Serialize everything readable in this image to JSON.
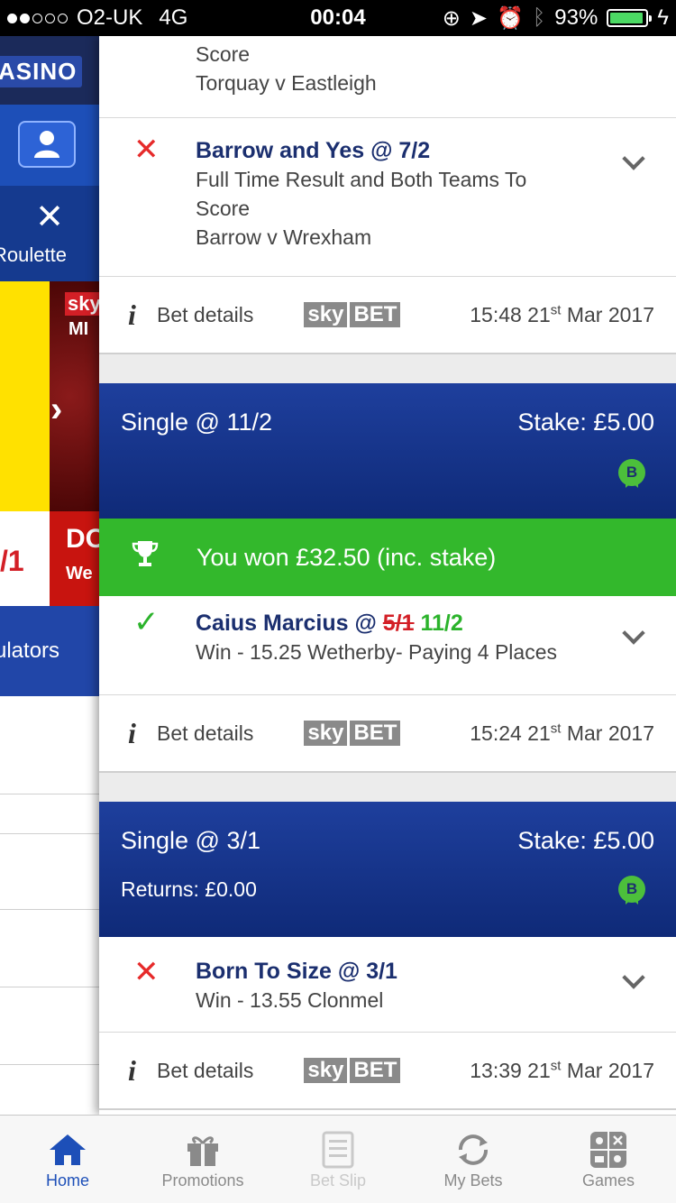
{
  "status_bar": {
    "carrier": "O2-UK",
    "network": "4G",
    "time": "00:04",
    "battery": "93%",
    "battery_level": 0.93
  },
  "left_app": {
    "casino_label": "ASINO",
    "roulette_label": "Roulette",
    "promo_sky": "sky",
    "promo_mi": "MI",
    "promo_odds": "/1",
    "promo_do": "DO",
    "promo_we": "We",
    "accumulators_label": "ulators"
  },
  "bets": {
    "bet1": {
      "partial_leg": {
        "desc_line": "Score",
        "match": "Torquay v Eastleigh"
      },
      "leg2": {
        "title": "Barrow and Yes @ 7/2",
        "market": "Full Time Result and Both Teams To Score",
        "match": "Barrow v Wrexham"
      },
      "details": {
        "label": "Bet details",
        "time": "15:48 21",
        "suffix": "st",
        "month": "Mar 2017"
      }
    },
    "bet2": {
      "single": "Single @ 11/2",
      "stake": "Stake: £5.00",
      "won_text": "You won £32.50 (inc. stake)",
      "leg": {
        "title_prefix": "Caius Marcius @ ",
        "old_odds": "5/1",
        "new_odds": "11/2",
        "desc": "Win - 15.25 Wetherby- Paying 4 Places"
      },
      "details": {
        "label": "Bet details",
        "time": "15:24 21",
        "suffix": "st",
        "month": "Mar 2017"
      }
    },
    "bet3": {
      "single": "Single @ 3/1",
      "stake": "Stake: £5.00",
      "returns": "Returns: £0.00",
      "leg": {
        "title": "Born To Size @ 3/1",
        "desc": "Win - 13.55 Clonmel"
      },
      "details": {
        "label": "Bet details",
        "time": "13:39 21",
        "suffix": "st",
        "month": "Mar 2017"
      }
    }
  },
  "badge_letter": "B",
  "skybet": {
    "sky": "sky",
    "bet": "BET"
  },
  "tabs": [
    {
      "label": "Home",
      "icon": "home-icon"
    },
    {
      "label": "Promotions",
      "icon": "gift-icon"
    },
    {
      "label": "Bet Slip",
      "icon": "betslip-icon"
    },
    {
      "label": "My Bets",
      "icon": "refresh-icon"
    },
    {
      "label": "Games",
      "icon": "games-icon"
    }
  ],
  "colors": {
    "brand_blue": "#1d4fb8",
    "won_green": "#33b82c",
    "lost_red": "#e62a2a",
    "title_navy": "#1b2f6f"
  }
}
